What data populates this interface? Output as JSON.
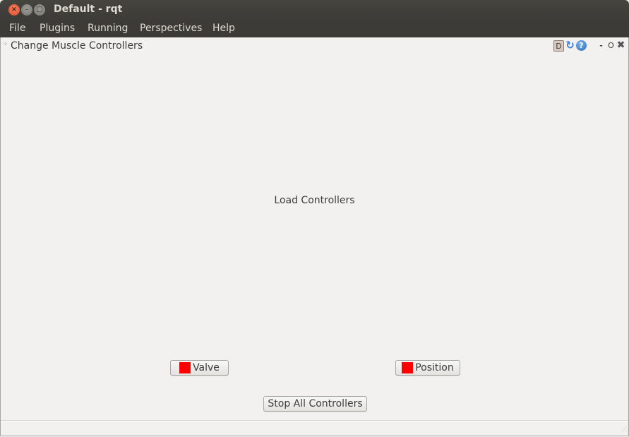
{
  "window": {
    "title": "Default - rqt",
    "controls": {
      "close": "×",
      "minimize": "–",
      "maximize": "□"
    }
  },
  "menubar": {
    "items": [
      "File",
      "Plugins",
      "Running",
      "Perspectives",
      "Help"
    ]
  },
  "plugin": {
    "title": "Change Muscle Controllers",
    "icon": "plugin-icon",
    "dock_buttons": {
      "d": "D",
      "reload": "↻",
      "help": "?",
      "minimize": "-",
      "float": "O",
      "close": "✖"
    }
  },
  "content": {
    "heading": "Load Controllers",
    "buttons": {
      "valve": {
        "label": "Valve",
        "status_color": "#ff0000"
      },
      "position": {
        "label": "Position",
        "status_color": "#ff0000"
      },
      "stop_all": {
        "label": "Stop All Controllers"
      }
    }
  }
}
